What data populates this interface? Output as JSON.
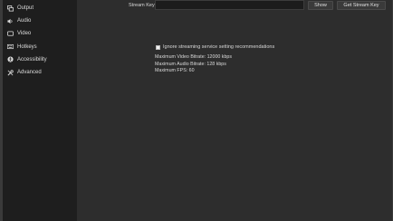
{
  "sidebar": {
    "items": [
      {
        "label": "Output",
        "icon": "output-icon"
      },
      {
        "label": "Audio",
        "icon": "speaker-icon"
      },
      {
        "label": "Video",
        "icon": "monitor-icon"
      },
      {
        "label": "Hotkeys",
        "icon": "keyboard-icon"
      },
      {
        "label": "Accessibility",
        "icon": "accessibility-icon"
      },
      {
        "label": "Advanced",
        "icon": "tools-icon"
      }
    ]
  },
  "stream": {
    "key_label": "Stream Key",
    "key_value": "",
    "show_label": "Show",
    "get_key_label": "Get Stream Key",
    "ignore_label": "Ignore streaming service setting recommendations",
    "max_video_bitrate": "Maximum Video Bitrate: 12000 kbps",
    "max_audio_bitrate": "Maximum Audio Bitrate: 128 kbps",
    "max_fps": "Maximum FPS: 60"
  }
}
